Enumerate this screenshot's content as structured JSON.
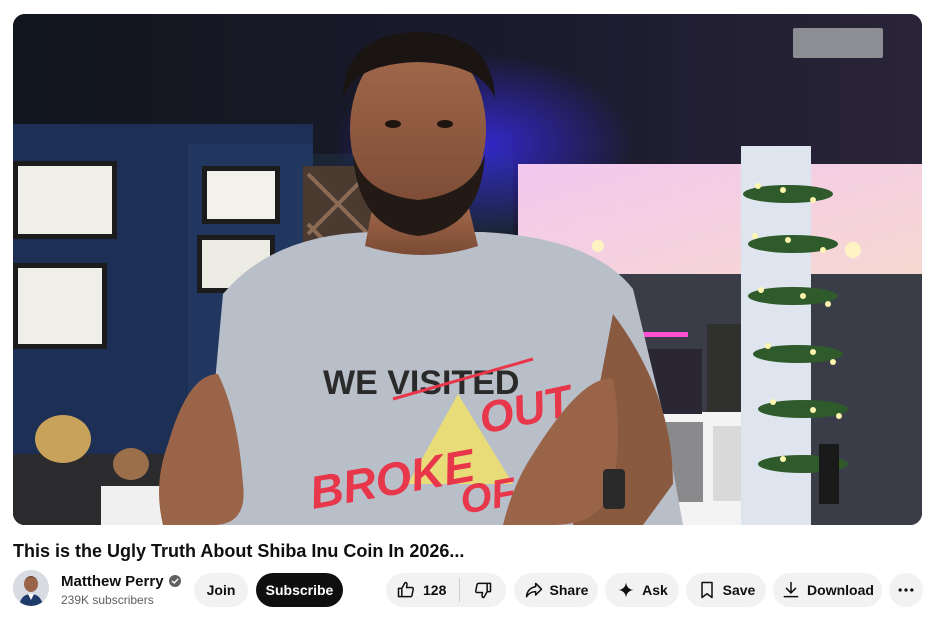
{
  "video": {
    "title": "This is the Ugly Truth About Shiba Inu Coin In 2026...",
    "shirt_text": {
      "line1": "WE VISITED",
      "over": "OUT",
      "broke": "BROKE",
      "of": "OF"
    }
  },
  "channel": {
    "name": "Matthew Perry",
    "subscribers": "239K subscribers",
    "verified_icon": "verified-check-icon"
  },
  "buttons": {
    "join": "Join",
    "subscribe": "Subscribe",
    "like_count": "128",
    "share": "Share",
    "ask": "Ask",
    "save": "Save",
    "download": "Download"
  },
  "icons": {
    "like": "thumbs-up-icon",
    "dislike": "thumbs-down-icon",
    "share": "share-arrow-icon",
    "ask": "sparkle-icon",
    "save": "bookmark-icon",
    "download": "download-icon",
    "more": "more-horizontal-icon"
  },
  "colors": {
    "subscribe_bg": "#0f0f0f",
    "pill_bg": "#f2f2f2",
    "text_primary": "#0f0f0f",
    "text_secondary": "#606060",
    "shirt_red": "#e8364a"
  }
}
